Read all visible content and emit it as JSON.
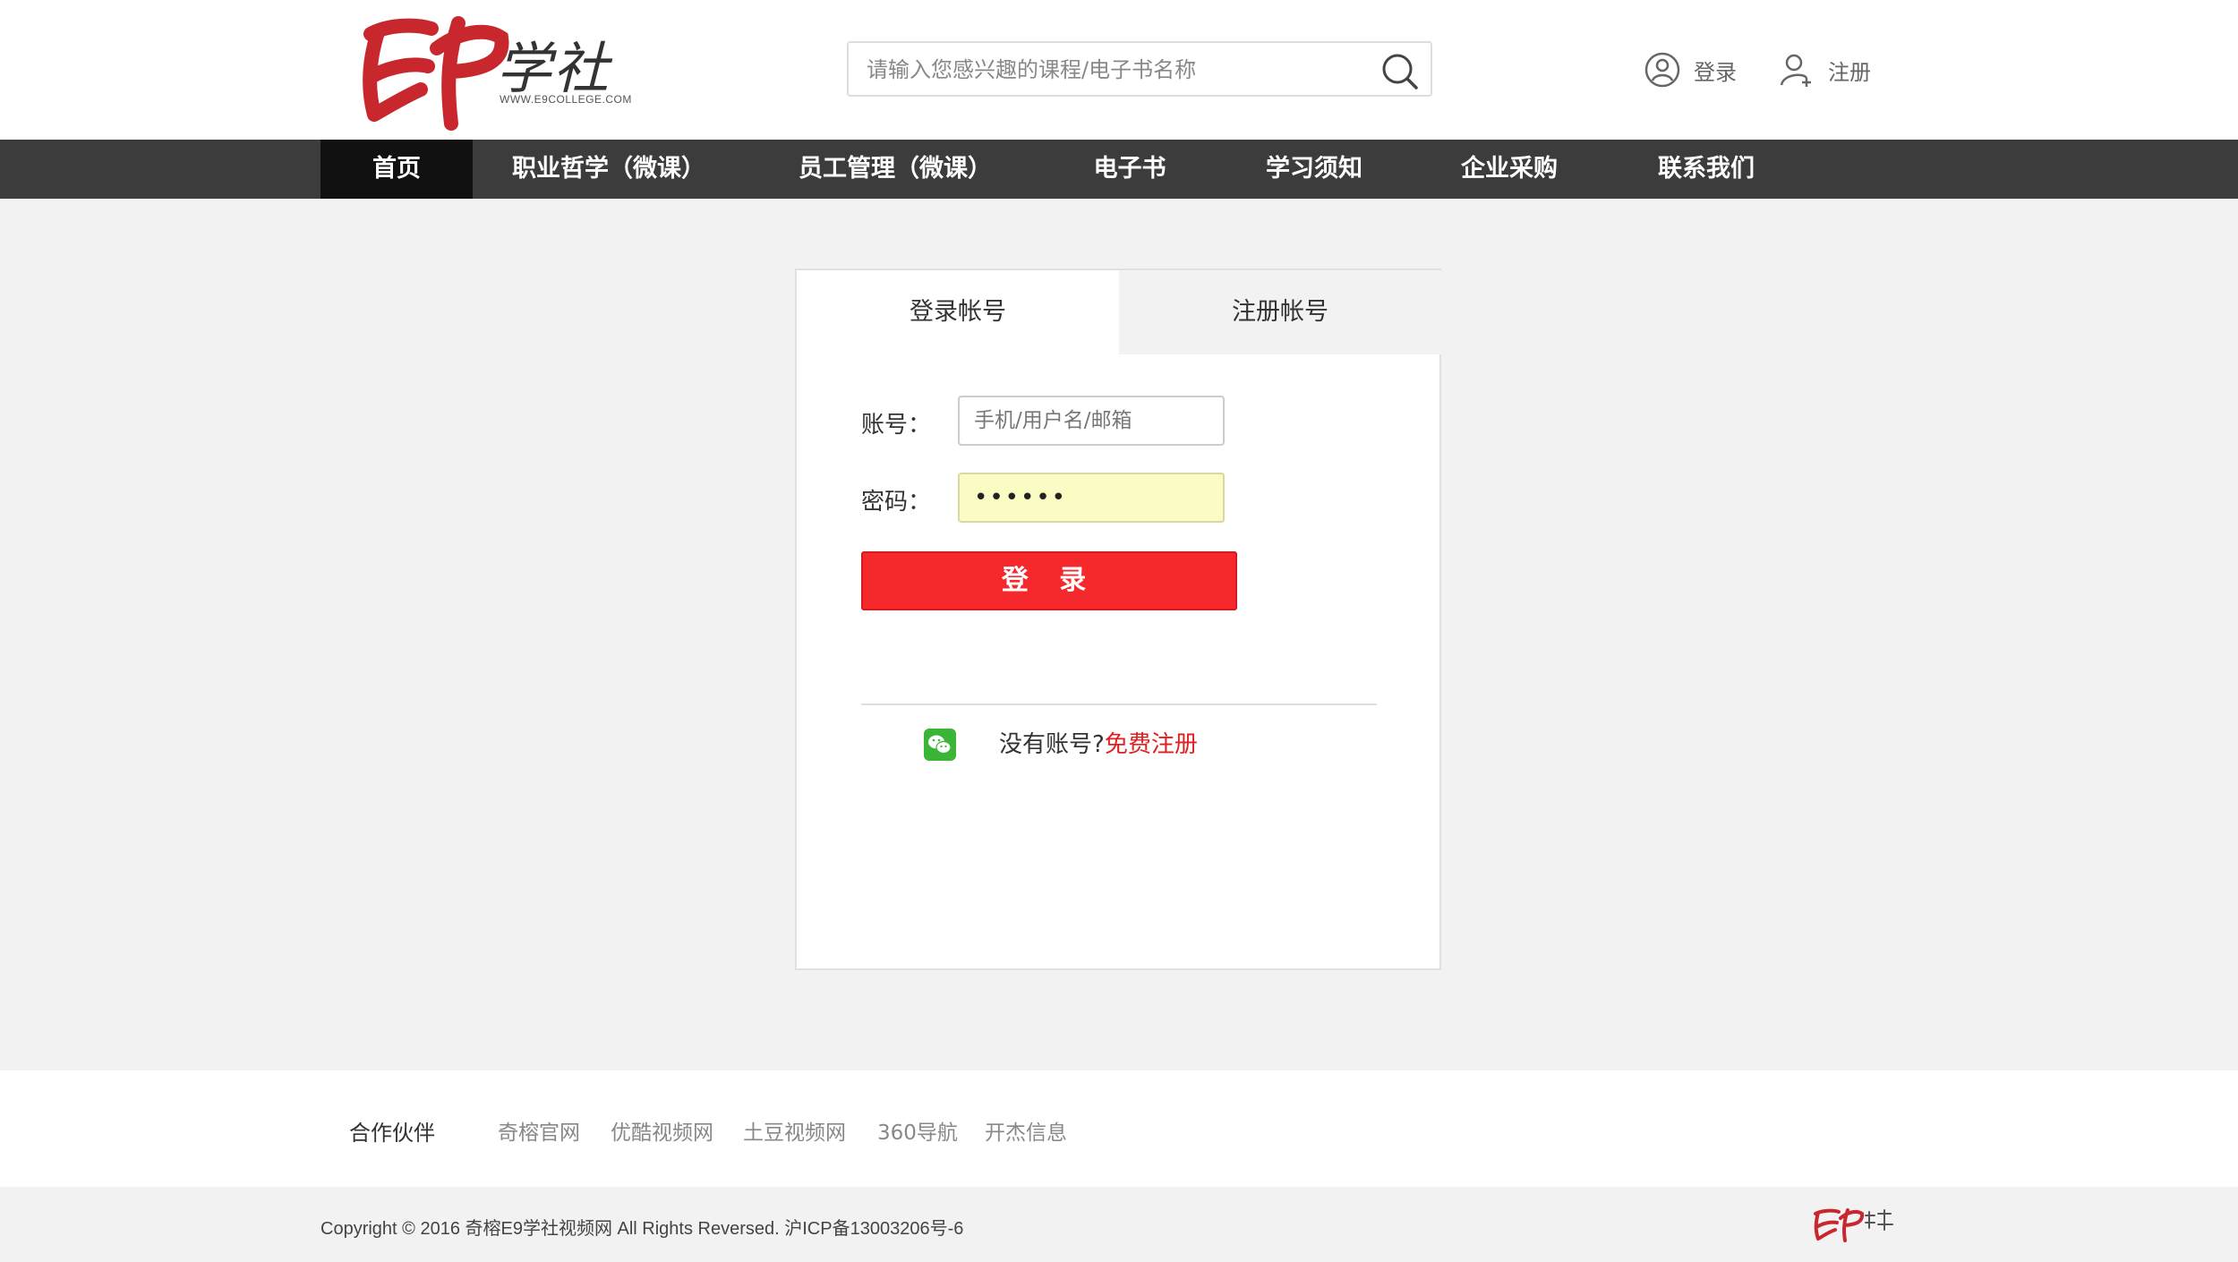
{
  "header": {
    "logo": {
      "text_cn": "学社",
      "url_text": "WWW.E9COLLEGE.COM"
    },
    "search": {
      "placeholder": "请输入您感兴趣的课程/电子书名称",
      "icon": "search-icon"
    },
    "login_label": "登录",
    "register_label": "注册"
  },
  "nav": {
    "items": [
      {
        "label": "首页",
        "active": true
      },
      {
        "label": "职业哲学（微课）"
      },
      {
        "label": "员工管理（微课）"
      },
      {
        "label": "电子书"
      },
      {
        "label": "学习须知"
      },
      {
        "label": "企业采购"
      },
      {
        "label": "联系我们"
      }
    ]
  },
  "login_card": {
    "tabs": [
      {
        "label": "登录帐号",
        "active": true
      },
      {
        "label": "注册帐号"
      }
    ],
    "account_label": "账号：",
    "account_placeholder": "手机/用户名/邮箱",
    "account_value": "",
    "password_label": "密码：",
    "password_value": "••••••",
    "login_button": "登 录",
    "no_account_text": "没有账号?",
    "free_register": "免费注册"
  },
  "partners": {
    "title": "合作伙伴",
    "links": [
      "奇榕官网",
      "优酷视频网",
      "土豆视频网",
      "360导航",
      "开杰信息"
    ]
  },
  "footer": {
    "copyright": "Copyright © 2016 奇榕E9学社视频网 All Rights Reversed. 沪ICP备13003206号-6"
  },
  "colors": {
    "brand_red": "#c8282d",
    "nav_bg": "#3c3c3c",
    "nav_active_bg": "#111111",
    "login_button": "#f5292c",
    "link_red": "#e02020"
  }
}
